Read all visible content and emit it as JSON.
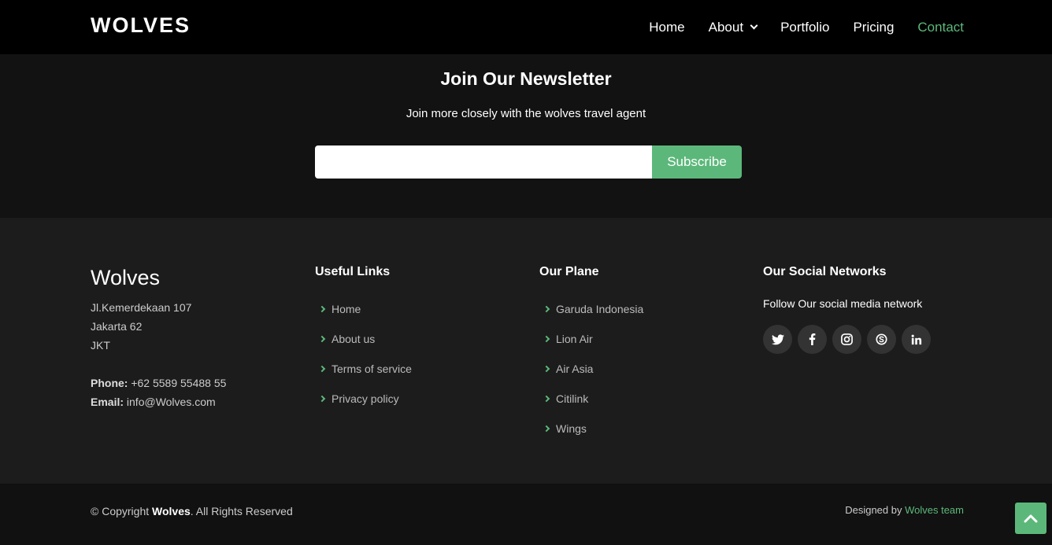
{
  "header": {
    "logo": "WOLVES",
    "nav": [
      {
        "label": "Home"
      },
      {
        "label": "About"
      },
      {
        "label": "Portfolio"
      },
      {
        "label": "Pricing"
      },
      {
        "label": "Contact"
      }
    ]
  },
  "newsletter": {
    "title": "Join Our Newsletter",
    "subtitle": "Join more closely with the wolves travel agent",
    "input_value": "",
    "button": "Subscribe"
  },
  "footer": {
    "brand": "Wolves",
    "address": [
      "Jl.Kemerdekaan 107",
      "Jakarta 62",
      "JKT"
    ],
    "phone_label": "Phone:",
    "phone": " +62 5589 55488 55",
    "email_label": "Email:",
    "email": " info@Wolves.com",
    "useful_links": {
      "title": "Useful Links",
      "items": [
        "Home",
        "About us",
        "Terms of service",
        "Privacy policy"
      ]
    },
    "planes": {
      "title": "Our Plane",
      "items": [
        "Garuda Indonesia",
        "Lion Air",
        "Air Asia",
        "Citilink",
        "Wings"
      ]
    },
    "social": {
      "title": "Our Social Networks",
      "text": "Follow Our social media network",
      "icons": [
        "twitter-icon",
        "facebook-icon",
        "instagram-icon",
        "skype-icon",
        "linkedin-icon"
      ]
    }
  },
  "bottom": {
    "copyright_prefix": "© Copyright ",
    "copyright_brand": "Wolves",
    "copyright_suffix": ". All Rights Reserved",
    "designed_by": "Designed by ",
    "designer": "Wolves team"
  },
  "colors": {
    "accent": "#5cb87a",
    "header_bg": "#000000",
    "newsletter_bg": "#121212",
    "footer_bg": "#1c1c1c",
    "bottom_bg": "#111111"
  }
}
